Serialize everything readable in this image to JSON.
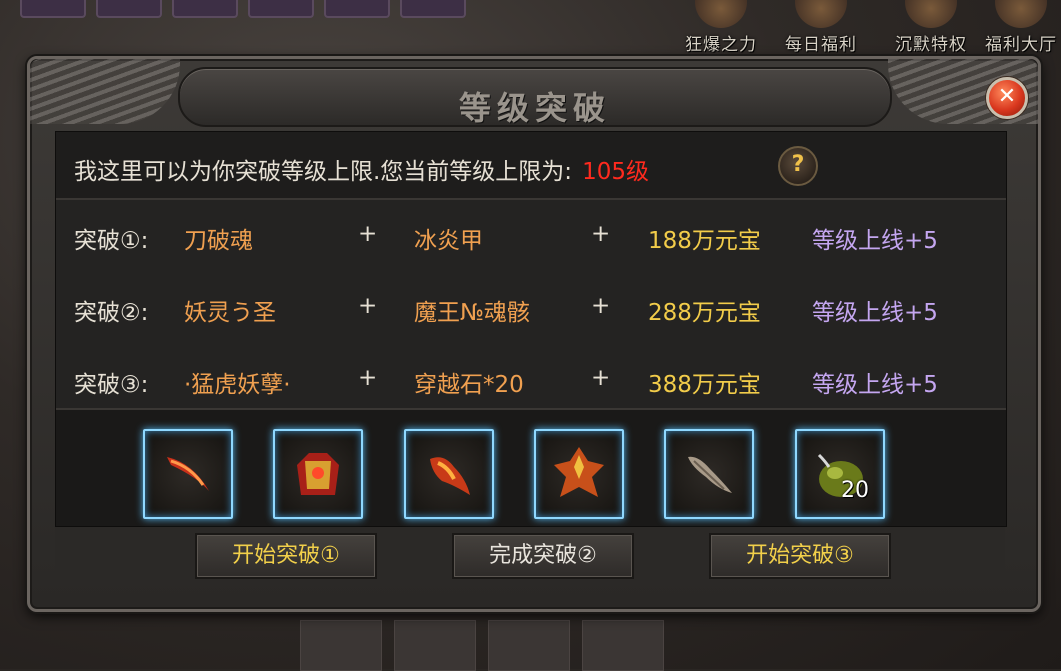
{
  "background": {
    "top_menu": [
      {
        "label": "狂爆之力",
        "icon": "rage-power-icon"
      },
      {
        "label": "每日福利",
        "icon": "daily-welfare-icon"
      },
      {
        "label": "沉默特权",
        "icon": "silence-privilege-icon"
      },
      {
        "label": "福利大厅",
        "icon": "welfare-hall-icon"
      }
    ]
  },
  "dialog": {
    "title": "等级突破",
    "close_icon": "close-icon",
    "info": {
      "text": "我这里可以为你突破等级上限.您当前等级上限为:",
      "level": "105级",
      "level_color": "#ff2a1e",
      "help_label": "?"
    },
    "recipes": [
      {
        "label": "突破①:",
        "item1": "刀破魂",
        "plus1": "+",
        "item2": "冰炎甲",
        "plus2": "+",
        "cost": "188万元宝",
        "reward": "等级上线+5"
      },
      {
        "label": "突破②:",
        "item1": "妖灵う圣",
        "plus1": "+",
        "item2": "魔王№魂骸",
        "plus2": "+",
        "cost": "288万元宝",
        "reward": "等级上线+5"
      },
      {
        "label": "突破③:",
        "item1": "·猛虎妖孽·",
        "plus1": "+",
        "item2": "穿越石*20",
        "plus2": "+",
        "cost": "388万元宝",
        "reward": "等级上线+5"
      }
    ],
    "items": [
      {
        "icon": "blade-item-icon",
        "count": ""
      },
      {
        "icon": "armor-item-icon",
        "count": ""
      },
      {
        "icon": "fire-claw-item-icon",
        "count": ""
      },
      {
        "icon": "demon-armor-item-icon",
        "count": ""
      },
      {
        "icon": "bone-relic-item-icon",
        "count": ""
      },
      {
        "icon": "travel-stone-item-icon",
        "count": "20"
      }
    ],
    "buttons": [
      {
        "label": "开始突破①"
      },
      {
        "label": "完成突破②"
      },
      {
        "label": "开始突破③"
      }
    ],
    "colors": {
      "item_name": "#f0a050",
      "cost": "#f2cc4a",
      "reward": "#c4a6f0",
      "slot_glow": "#8fd8ff"
    }
  }
}
